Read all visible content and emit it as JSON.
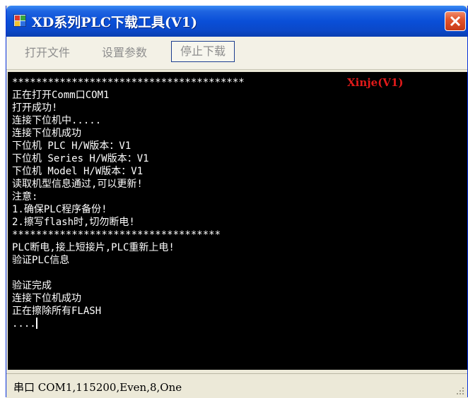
{
  "window": {
    "title": "XD系列PLC下载工具(V1)"
  },
  "toolbar": {
    "open_file": "打开文件",
    "settings": "设置参数",
    "stop_download": "停止下载"
  },
  "console": {
    "brand": "Xinje(V1)",
    "lines": [
      "***************************************",
      "正在打开Comm口COM1",
      "打开成功!",
      "连接下位机中.....",
      "连接下位机成功",
      "下位机 PLC H/W版本：V1",
      "下位机 Series H/W版本：V1",
      "下位机 Model H/W版本：V1",
      "读取机型信息通过,可以更新!",
      "注意:",
      "1.确保PLC程序备份!",
      "2.擦写flash时,切勿断电!",
      "***********************************",
      "PLC断电,接上短接片,PLC重新上电!",
      "验证PLC信息",
      "",
      "验证完成",
      "连接下位机成功",
      "正在擦除所有FLASH",
      "...."
    ]
  },
  "statusbar": {
    "text": "串口 COM1,115200,Even,8,One"
  },
  "icons": {
    "app": "app-icon",
    "close": "close-icon",
    "grip": "resize-grip-icon"
  },
  "colors": {
    "titlebar": "#0a4fd8",
    "console_bg": "#000000",
    "console_text": "#ffffff",
    "brand_text": "#e01a1a",
    "close_button": "#e2542c"
  }
}
